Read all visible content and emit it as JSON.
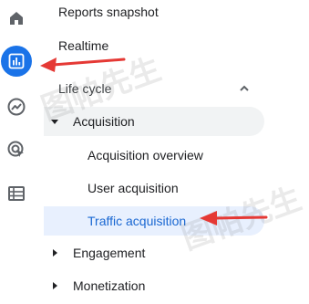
{
  "rail": {
    "icons": [
      "home-icon",
      "reports-icon",
      "explore-icon",
      "advertising-icon",
      "configure-icon"
    ],
    "active_color": "#1a73e8"
  },
  "nav": {
    "reports_snapshot": "Reports snapshot",
    "realtime": "Realtime",
    "life_cycle": {
      "label": "Life cycle",
      "expanded": true,
      "items": {
        "acquisition": {
          "label": "Acquisition",
          "expanded": true,
          "children": [
            "Acquisition overview",
            "User acquisition",
            "Traffic acquisition"
          ],
          "selected": "Traffic acquisition"
        },
        "engagement": "Engagement",
        "monetization": "Monetization"
      }
    }
  },
  "watermark": "图帕先生",
  "colors": {
    "selected_bg": "#e8f0fe",
    "selected_text": "#1967d2",
    "section_bg": "#f1f3f4",
    "arrow": "#e53935"
  }
}
